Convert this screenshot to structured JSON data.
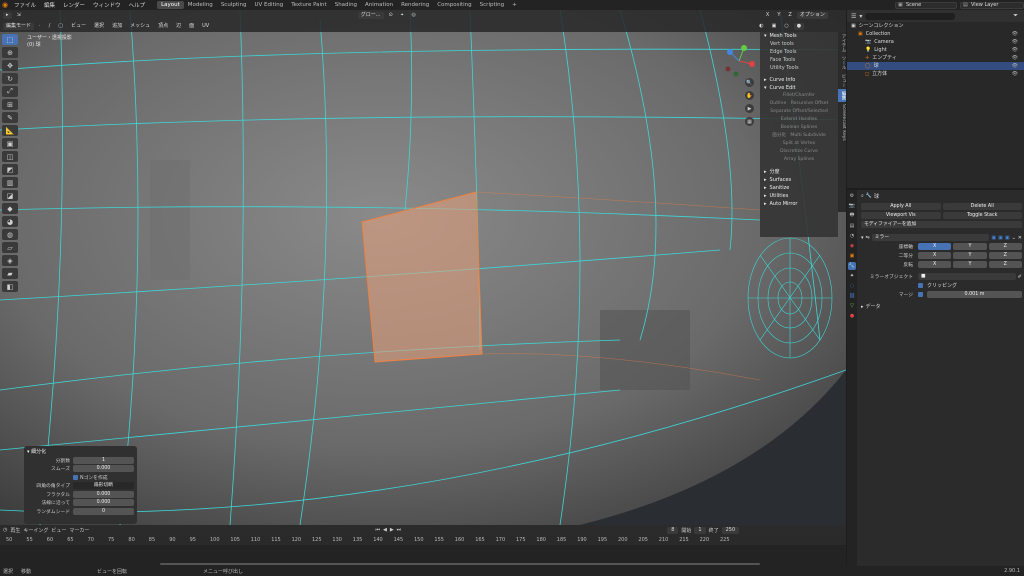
{
  "menubar": {
    "items": [
      "ファイル",
      "編集",
      "レンダー",
      "ウィンドウ",
      "ヘルプ"
    ],
    "workspaces": [
      "Layout",
      "Modeling",
      "Sculpting",
      "UV Editing",
      "Texture Paint",
      "Shading",
      "Animation",
      "Rendering",
      "Compositing",
      "Scripting",
      "+"
    ],
    "active_workspace": "Layout",
    "scene": "Scene",
    "view_layer": "View Layer"
  },
  "viewport": {
    "mode": "編集モード",
    "header_menus": [
      "ビュー",
      "選択",
      "追加",
      "メッシュ",
      "頂点",
      "辺",
      "面",
      "UV"
    ],
    "transform_orientation": "グロー...",
    "axes": [
      "X",
      "Y",
      "Z"
    ],
    "options": "オプション",
    "view_name": "ユーザー・透視投影",
    "object_name": "(0) 球"
  },
  "npanel": {
    "tabs": [
      "アイテム",
      "ツール",
      "ビュー",
      "編集",
      "Screencast Keys"
    ],
    "active_tab": "編集",
    "mesh_tools_title": "Mesh Tools",
    "mesh_tools": [
      "Vert tools",
      "Edge Tools",
      "Face Tools",
      "Utility Tools"
    ],
    "curve_info": "Curve Info",
    "curve_edit": "Curve Edit",
    "curve_ops": [
      "Fillet/Chamfer",
      "Outline",
      "Recursive Offset",
      "Separate Offset/Selected",
      "Extend Handles",
      "Boolean Splines",
      "画分化",
      "Multi Subdivide",
      "Split at Vertex",
      "Discretize Curve",
      "Array Splines"
    ],
    "sections": [
      "分度",
      "Surfaces",
      "Sanitize",
      "Utilities",
      "Auto Mirror"
    ]
  },
  "operator_panel": {
    "title": "細分化",
    "fields": [
      {
        "label": "分割数",
        "value": "1"
      },
      {
        "label": "スムーズ",
        "value": "0.000"
      }
    ],
    "checkbox_label": "Nゴンを作成",
    "corner_label": "四角の角タイプ",
    "corner_value": "扇形切断",
    "fields2": [
      {
        "label": "フラクタル",
        "value": "0.000"
      },
      {
        "label": "法線に沿って",
        "value": "0.000"
      },
      {
        "label": "ランダムシード",
        "value": "0"
      }
    ]
  },
  "timeline": {
    "header": [
      "再生",
      "キーイング",
      "ビュー",
      "マーカー"
    ],
    "current_frame": "8",
    "start_label": "開始",
    "start": "1",
    "end_label": "終了",
    "end": "250",
    "ticks": [
      "50",
      "55",
      "60",
      "65",
      "70",
      "75",
      "80",
      "85",
      "90",
      "95",
      "100",
      "105",
      "110",
      "115",
      "120",
      "125",
      "130",
      "135",
      "140",
      "145",
      "150",
      "155",
      "160",
      "165",
      "170",
      "175",
      "180",
      "185",
      "190",
      "195",
      "200",
      "205",
      "210",
      "215",
      "220",
      "225"
    ]
  },
  "statusbar": {
    "items": [
      "選択",
      "移動",
      "ビューを回転",
      "メニュー呼び出し"
    ],
    "version": "2.90.1"
  },
  "outliner": {
    "root": "シーンコレクション",
    "rows": [
      {
        "label": "Collection",
        "indent": 1,
        "selected": false
      },
      {
        "label": "Camera",
        "indent": 2,
        "selected": false
      },
      {
        "label": "Light",
        "indent": 2,
        "selected": false
      },
      {
        "label": "エンプティ",
        "indent": 2,
        "selected": false
      },
      {
        "label": "球",
        "indent": 2,
        "selected": true
      },
      {
        "label": "立方体",
        "indent": 2,
        "selected": false
      }
    ]
  },
  "properties": {
    "object": "球",
    "apply_all": "Apply All",
    "delete_all": "Delete All",
    "viewport_vis": "Viewport Vis",
    "toggle_stack": "Toggle Stack",
    "add_modifier": "モディファイアーを追加",
    "modifier_name": "ミラー",
    "axis_label": "座標軸",
    "bisect_label": "二等分",
    "flip_label": "反転",
    "axes": [
      "X",
      "Y",
      "Z"
    ],
    "mirror_object": "ミラーオブジェクト",
    "clipping": "クリッピング",
    "merge_label": "マージ",
    "merge_value": "0.001 m",
    "data": "データ"
  },
  "colors": {
    "accent": "#4772b3",
    "wire": "#3fd6d6",
    "selected_face": "#e8a07c",
    "brand": "#e87d0d"
  }
}
